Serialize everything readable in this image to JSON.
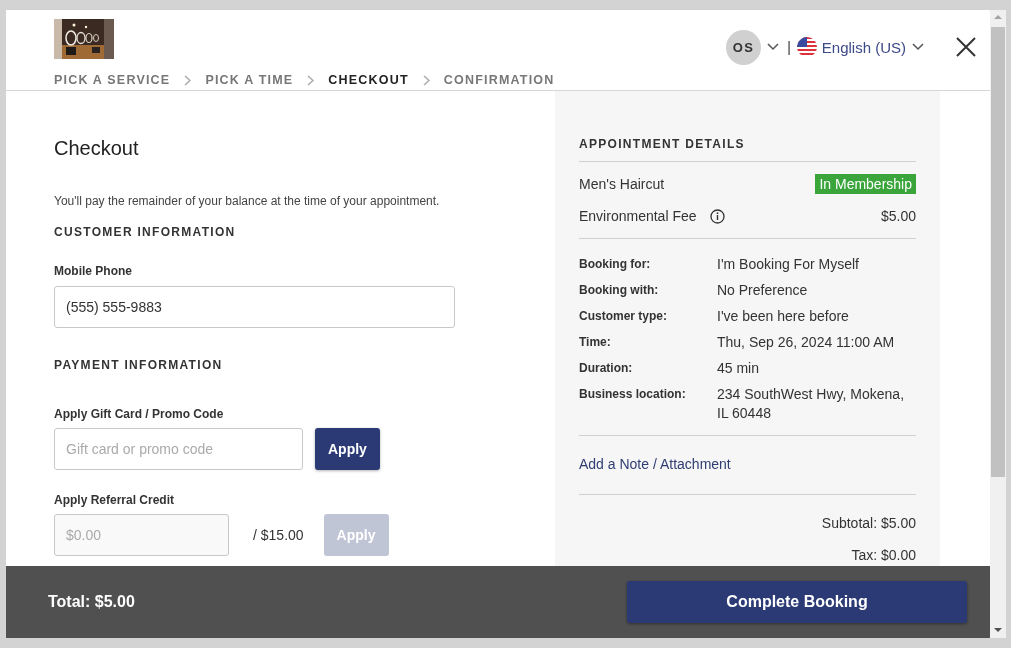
{
  "steps": [
    {
      "label": "PICK A SERVICE",
      "selected": false
    },
    {
      "label": "PICK A TIME",
      "selected": false
    },
    {
      "label": "CHECKOUT",
      "selected": true
    },
    {
      "label": "CONFIRMATION",
      "selected": false
    }
  ],
  "account": {
    "initials": "OS"
  },
  "language": {
    "separator": "|",
    "label": "English (US)"
  },
  "checkout": {
    "title": "Checkout",
    "note": "You'll pay the remainder of your balance at the time of your appointment.",
    "customer_heading": "CUSTOMER INFORMATION",
    "phone": {
      "label": "Mobile Phone",
      "value": "(555) 555-9883"
    },
    "payment_heading": "PAYMENT INFORMATION",
    "promo": {
      "label": "Apply Gift Card / Promo Code",
      "placeholder": "Gift card or promo code",
      "button": "Apply",
      "disabled": false
    },
    "referral": {
      "label": "Apply Referral Credit",
      "placeholder": "$0.00",
      "limit": "/ $15.00",
      "button": "Apply",
      "disabled": true
    }
  },
  "appointment": {
    "heading": "APPOINTMENT DETAILS",
    "services": [
      {
        "name": "Men's Haircut",
        "badge": "In Membership",
        "color": "#3aa53a"
      },
      {
        "name": "Environmental Fee",
        "info": true,
        "price": "$5.00"
      }
    ],
    "details": [
      {
        "label": "Booking for:",
        "value": "I'm Booking For Myself"
      },
      {
        "label": "Booking with:",
        "value": "No Preference"
      },
      {
        "label": "Customer type:",
        "value": "I've been here before"
      },
      {
        "label": "Time:",
        "value": "Thu, Sep 26, 2024 11:00 AM"
      },
      {
        "label": "Duration:",
        "value": "45 min"
      },
      {
        "label": "Business location:",
        "value": "234 SouthWest Hwy, Mokena, IL 60448"
      }
    ],
    "note_link": "Add a Note / Attachment",
    "subtotal": "Subtotal: $5.00",
    "tax": "Tax: $0.00"
  },
  "footer": {
    "total": "Total: $5.00",
    "button": "Complete Booking"
  }
}
